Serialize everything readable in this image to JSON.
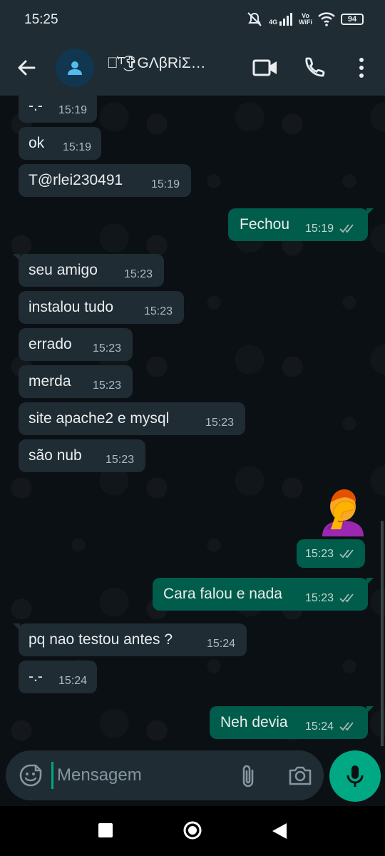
{
  "status_bar": {
    "time": "15:25",
    "network": "4G",
    "vowifi_top": "Vo",
    "vowifi_bottom": "WiFi",
    "battery": "94"
  },
  "header": {
    "contact_name": "♛͛ᵀ͜͡✞GΛβRiΣ…"
  },
  "messages": [
    {
      "dir": "in",
      "text": "-.-",
      "time": "15:19"
    },
    {
      "dir": "in",
      "text": "ok",
      "time": "15:19"
    },
    {
      "dir": "in",
      "text": "T@rlei230491",
      "time": "15:19"
    },
    {
      "dir": "out",
      "text": "Fechou",
      "time": "15:19"
    },
    {
      "dir": "in",
      "text": "seu amigo",
      "time": "15:23"
    },
    {
      "dir": "in",
      "text": "instalou tudo",
      "time": "15:23"
    },
    {
      "dir": "in",
      "text": "errado",
      "time": "15:23"
    },
    {
      "dir": "in",
      "text": "merda",
      "time": "15:23"
    },
    {
      "dir": "in",
      "text": "site apache2 e mysql",
      "time": "15:23"
    },
    {
      "dir": "in",
      "text": "são nub",
      "time": "15:23"
    },
    {
      "dir": "out",
      "text": "",
      "time": "15:23",
      "emoji": "person-facepalming"
    },
    {
      "dir": "out",
      "text": "Cara falou e nada",
      "time": "15:23"
    },
    {
      "dir": "in",
      "text": "pq nao testou antes ?",
      "time": "15:24"
    },
    {
      "dir": "in",
      "text": "-.-",
      "time": "15:24"
    },
    {
      "dir": "out",
      "text": "Neh devia",
      "time": "15:24"
    }
  ],
  "composer": {
    "placeholder": "Mensagem"
  },
  "colors": {
    "bar": "#1f2c34",
    "incoming": "#1f2c34",
    "outgoing": "#005c4b",
    "accent": "#00a884",
    "background": "#0b1014"
  }
}
